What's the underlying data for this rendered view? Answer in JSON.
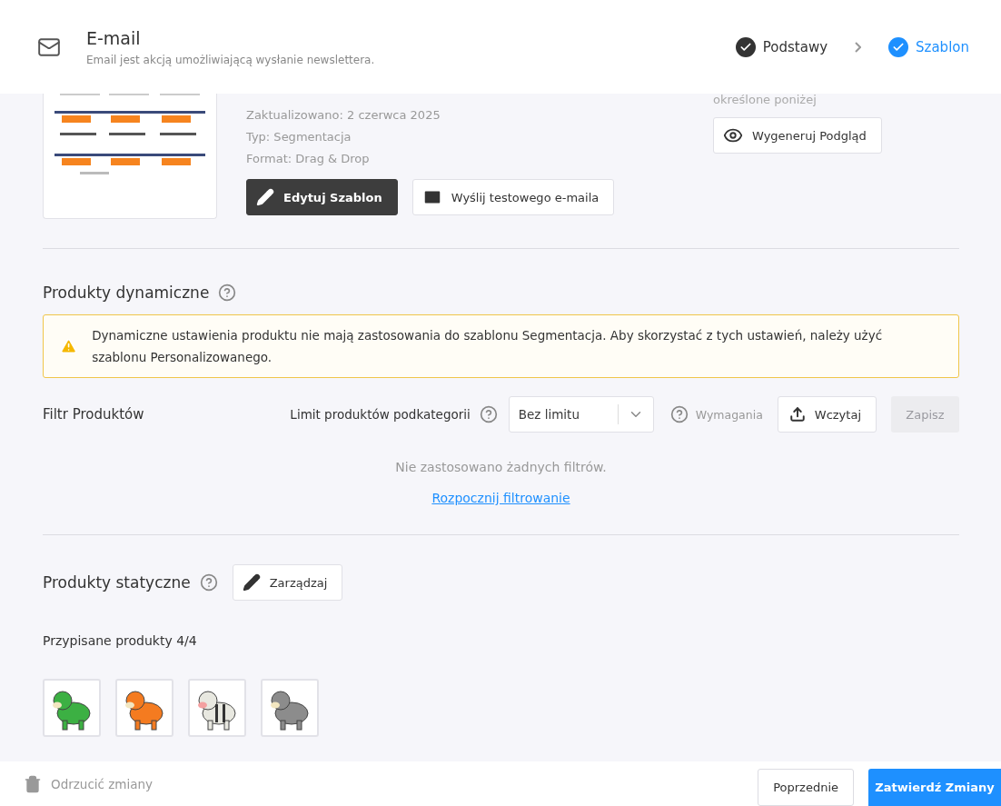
{
  "header": {
    "title": "E-mail",
    "subtitle": "Email jest akcją umożliwiającą wysłanie newslettera.",
    "steps": [
      {
        "label": "Podstawy",
        "selected": false
      },
      {
        "label": "Szablon",
        "selected": true
      }
    ]
  },
  "template": {
    "thumbnail": {
      "kind": "picture"
    },
    "meta": [
      "Zaktualizowano: 2 czerwca 2025",
      "Typ: Segmentacja",
      "Format: Drag & Drop"
    ],
    "edit_button": "Edytuj Szablon",
    "test_button": "Wyślij testowego e-maila",
    "preview_note": "określone poniżej",
    "preview_button": "Wygeneruj Podgląd"
  },
  "dynamic": {
    "title": "Produkty dynamiczne",
    "alert": "Dynamiczne ustawienia produktu nie mają zastosowania do szablonu Segmentacja. Aby skorzystać z tych ustawień, należy użyć szablonu Personalizowanego.",
    "filter_title": "Filtr Produktów",
    "limit_label": "Limit produktów podkategorii",
    "limit_value": "Bez limitu",
    "requirements": "Wymagania",
    "upload_button": "Wczytaj",
    "save_button": {
      "label": "Zapisz",
      "disabled": true
    },
    "empty_text": "Nie zastosowano żadnych filtrów.",
    "start_link": "Rozpocznij filtrowanie"
  },
  "static": {
    "title": "Produkty statyczne",
    "manage_button": "Zarządzaj",
    "assigned": "Przypisane produkty 4/4",
    "products": [
      {
        "kind": "picture"
      },
      {
        "kind": "picture"
      },
      {
        "kind": "picture"
      },
      {
        "kind": "picture"
      }
    ]
  },
  "footer": {
    "discard": "Odrzucić zmiany",
    "previous": "Poprzednie",
    "confirm": "Zatwierdź Zmiany"
  }
}
